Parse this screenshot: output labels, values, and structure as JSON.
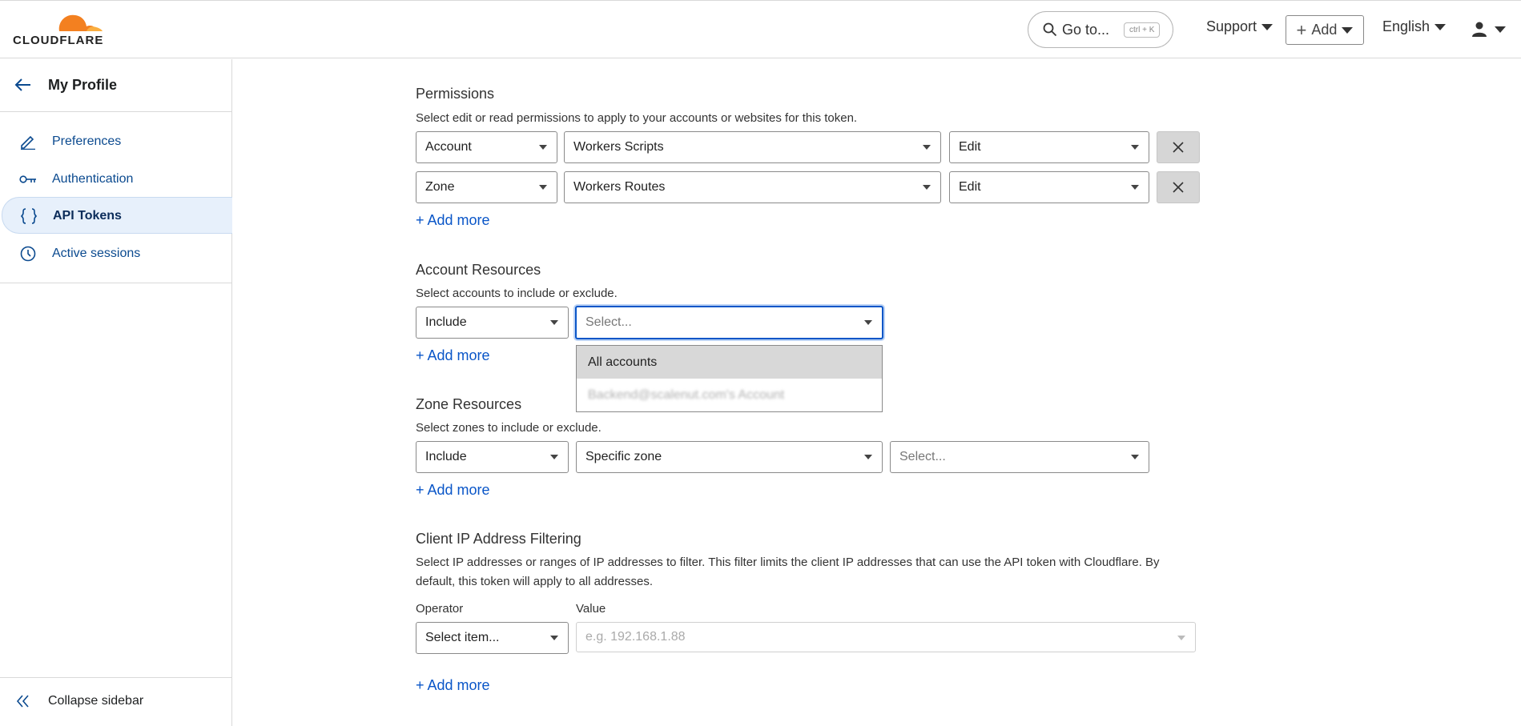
{
  "header": {
    "brand": "CLOUDFLARE",
    "goto_label": "Go to...",
    "goto_shortcut": "ctrl + K",
    "support_label": "Support",
    "add_label": "Add",
    "language_label": "English"
  },
  "sidebar": {
    "title": "My Profile",
    "items": [
      {
        "label": "Preferences",
        "icon": "pencil-icon",
        "active": false
      },
      {
        "label": "Authentication",
        "icon": "key-icon",
        "active": false
      },
      {
        "label": "API Tokens",
        "icon": "braces-icon",
        "active": true
      },
      {
        "label": "Active sessions",
        "icon": "clock-icon",
        "active": false
      }
    ],
    "collapse_label": "Collapse sidebar"
  },
  "permissions": {
    "title": "Permissions",
    "description": "Select edit or read permissions to apply to your accounts or websites for this token.",
    "rows": [
      {
        "scope": "Account",
        "resource": "Workers Scripts",
        "access": "Edit"
      },
      {
        "scope": "Zone",
        "resource": "Workers Routes",
        "access": "Edit"
      }
    ],
    "add_more": "+ Add more"
  },
  "account_resources": {
    "title": "Account Resources",
    "description": "Select accounts to include or exclude.",
    "mode": "Include",
    "select_placeholder": "Select...",
    "dropdown_options": [
      "All accounts",
      "Backend@scalenut.com's Account"
    ],
    "add_more": "+ Add more"
  },
  "zone_resources": {
    "title": "Zone Resources",
    "description": "Select zones to include or exclude.",
    "mode": "Include",
    "zone_type": "Specific zone",
    "zone_placeholder": "Select...",
    "add_more": "+ Add more"
  },
  "ip_filtering": {
    "title": "Client IP Address Filtering",
    "description": "Select IP addresses or ranges of IP addresses to filter. This filter limits the client IP addresses that can use the API token with Cloudflare. By default, this token will apply to all addresses.",
    "operator_label": "Operator",
    "operator_placeholder": "Select item...",
    "value_label": "Value",
    "value_placeholder": "e.g. 192.168.1.88",
    "add_more": "+ Add more"
  },
  "colors": {
    "brand_orange": "#f38020",
    "link_blue": "#0a56c8",
    "active_bg": "#e7f0fb"
  }
}
